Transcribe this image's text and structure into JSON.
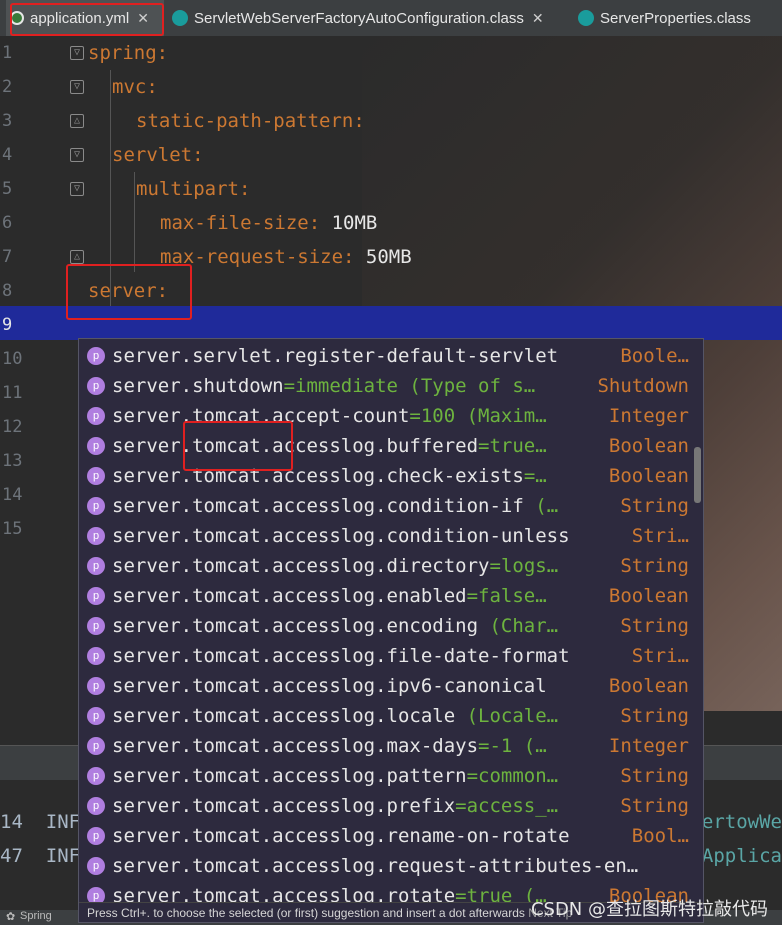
{
  "tabs": [
    {
      "label": "application.yml",
      "icon": "yaml-file-icon",
      "active": true
    },
    {
      "label": "ServletWebServerFactoryAutoConfiguration.class",
      "icon": "class-file-icon"
    },
    {
      "label": "ServerProperties.class",
      "icon": "class-file-icon"
    }
  ],
  "editor": {
    "lines": [
      {
        "num": "1",
        "key": "spring",
        "sep": ":",
        "value": ""
      },
      {
        "num": "2",
        "key": "mvc",
        "sep": ":",
        "value": ""
      },
      {
        "num": "3",
        "key": "static-path-pattern",
        "sep": ":",
        "value": ""
      },
      {
        "num": "4",
        "key": "servlet",
        "sep": ":",
        "value": ""
      },
      {
        "num": "5",
        "key": "multipart",
        "sep": ":",
        "value": ""
      },
      {
        "num": "6",
        "key": "max-file-size",
        "sep": ":",
        "value": " 10MB"
      },
      {
        "num": "7",
        "key": "max-request-size",
        "sep": ":",
        "value": " 50MB"
      },
      {
        "num": "8",
        "key": "server",
        "sep": ":",
        "value": ""
      },
      {
        "num": "9",
        "key": "",
        "sep": "",
        "value": ""
      },
      {
        "num": "10"
      },
      {
        "num": "11"
      },
      {
        "num": "12"
      },
      {
        "num": "13"
      },
      {
        "num": "14"
      },
      {
        "num": "15"
      }
    ]
  },
  "completion": {
    "items": [
      {
        "name": "server.servlet.register-default-servlet",
        "hint": "",
        "type": "Boole…"
      },
      {
        "name": "server.shutdown",
        "hint": "=immediate (Type of s…",
        "type": "Shutdown"
      },
      {
        "name": "server.tomcat.accept-count",
        "hint": "=100 (Maxim…",
        "type": "Integer"
      },
      {
        "name": "server.tomcat.accesslog.buffered",
        "hint": "=true…",
        "type": "Boolean"
      },
      {
        "name": "server.tomcat.accesslog.check-exists",
        "hint": "=…",
        "type": "Boolean"
      },
      {
        "name": "server.tomcat.accesslog.condition-if",
        "hint": " (…",
        "type": "String"
      },
      {
        "name": "server.tomcat.accesslog.condition-unless",
        "hint": "",
        "type": "Stri…"
      },
      {
        "name": "server.tomcat.accesslog.directory",
        "hint": "=logs…",
        "type": "String"
      },
      {
        "name": "server.tomcat.accesslog.enabled",
        "hint": "=false…",
        "type": "Boolean"
      },
      {
        "name": "server.tomcat.accesslog.encoding",
        "hint": " (Char…",
        "type": "String"
      },
      {
        "name": "server.tomcat.accesslog.file-date-format",
        "hint": "",
        "type": "Stri…"
      },
      {
        "name": "server.tomcat.accesslog.ipv6-canonical",
        "hint": "",
        "type": "Boolean"
      },
      {
        "name": "server.tomcat.accesslog.locale",
        "hint": " (Locale…",
        "type": "String"
      },
      {
        "name": "server.tomcat.accesslog.max-days",
        "hint": "=-1 (…",
        "type": "Integer"
      },
      {
        "name": "server.tomcat.accesslog.pattern",
        "hint": "=common…",
        "type": "String"
      },
      {
        "name": "server.tomcat.accesslog.prefix",
        "hint": "=access_…",
        "type": "String"
      },
      {
        "name": "server.tomcat.accesslog.rename-on-rotate",
        "hint": "",
        "type": "Bool…"
      },
      {
        "name": "server.tomcat.accesslog.request-attributes-en…",
        "hint": "",
        "type": ""
      },
      {
        "name": "server.tomcat.accesslog.rotate",
        "hint": "=true (…",
        "type": "Boolean"
      }
    ],
    "footer": "Press Ctrl+. to choose the selected (or first) suggestion and insert a dot afterwards",
    "footer_link": "Next Tip"
  },
  "bottom": {
    "rows": [
      {
        "left": "14  INF",
        "right": "ertowWe"
      },
      {
        "left": "47  INF",
        "right": "Applica"
      }
    ],
    "status_label": "Spring"
  },
  "watermark": "CSDN @查拉图斯特拉敲代码",
  "colors": {
    "accent": "#cc7832",
    "current_line": "#1f2a9a",
    "highlight_box": "#e02020"
  }
}
